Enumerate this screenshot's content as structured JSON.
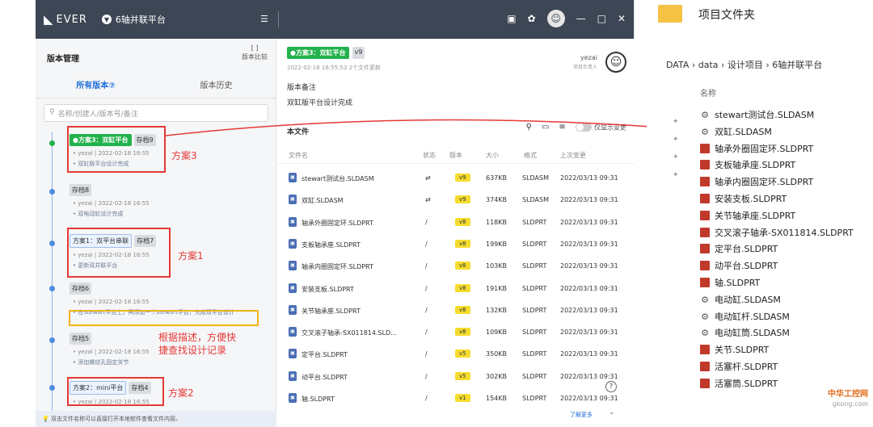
{
  "titlebar": {
    "logo": "EVER",
    "project": "6轴并联平台",
    "menu_icon": "hamburger-icon"
  },
  "left": {
    "title": "版本管理",
    "compare": "版本比较",
    "tabs": [
      {
        "label": "所有版本⑦"
      },
      {
        "label": "版本历史"
      }
    ],
    "search_placeholder": "名称/创建人/版本号/备注",
    "versions": [
      {
        "name": "●方案3：双缸平台",
        "save": "存档9",
        "meta": "• yezai | 2022-02-18 16:55",
        "desc": "• 双缸版平台设计完成"
      },
      {
        "save": "存档8",
        "meta": "• yezai | 2022-02-18 16:55",
        "desc": "• 双电动缸设计完成"
      },
      {
        "name": "方案1：双平台串联",
        "save": "存档7",
        "meta": "• yezai | 2022-02-18 16:55",
        "desc": "• 更新双并联平台"
      },
      {
        "save": "存档6",
        "meta": "• yezai | 2022-02-18 16:55",
        "desc": "• 在Stewart平台上，再添加一个stewart平台，完成双平台设计"
      },
      {
        "save": "存档5",
        "meta": "• yezai | 2022-02-18 16:55",
        "desc": "• 添加螺纹孔固定关节"
      },
      {
        "name": "方案2：mini平台",
        "save": "存档4",
        "meta": "• yezai | 2022-02-18 16:55"
      }
    ],
    "footer": "双击文件名称可以直接打开本地软件查看文件内容。"
  },
  "annotations": {
    "plan3": "方案3",
    "plan1": "方案1",
    "desc": "根据描述，方便快\n捷查找设计记录",
    "plan2": "方案2"
  },
  "mid": {
    "plan": "●方案3：双缸平台",
    "plan_ver": "v9",
    "sub": "2022-02-18 16:55:53 2个文件更新",
    "user": "yezai",
    "user_role": "项目负责人",
    "note_label": "版本备注",
    "note_text": "双缸版平台设计完成",
    "files_header": "本文件",
    "toggle_label": "仅显示变更",
    "columns": [
      "文件名",
      "状态",
      "版本",
      "大小",
      "格式",
      "上次变更"
    ],
    "files": [
      {
        "name": "stewart测试台.SLDASM",
        "status": "⇄",
        "ver": "v9",
        "size": "637KB",
        "fmt": "SLDASM",
        "date": "2022/03/13 09:31"
      },
      {
        "name": "双缸.SLDASM",
        "status": "⇄",
        "ver": "v9",
        "size": "374KB",
        "fmt": "SLDASM",
        "date": "2022/03/13 09:31"
      },
      {
        "name": "轴承外圈固定环.SLDPRT",
        "status": "/",
        "ver": "v8",
        "size": "118KB",
        "fmt": "SLDPRT",
        "date": "2022/03/13 09:31"
      },
      {
        "name": "支板轴承座.SLDPRT",
        "status": "/",
        "ver": "v8",
        "size": "199KB",
        "fmt": "SLDPRT",
        "date": "2022/03/13 09:31"
      },
      {
        "name": "轴承内圈固定环.SLDPRT",
        "status": "/",
        "ver": "v8",
        "size": "103KB",
        "fmt": "SLDPRT",
        "date": "2022/03/13 09:31"
      },
      {
        "name": "安装支板.SLDPRT",
        "status": "/",
        "ver": "v8",
        "size": "191KB",
        "fmt": "SLDPRT",
        "date": "2022/03/13 09:31"
      },
      {
        "name": "关节轴承座.SLDPRT",
        "status": "/",
        "ver": "v8",
        "size": "132KB",
        "fmt": "SLDPRT",
        "date": "2022/03/13 09:31"
      },
      {
        "name": "交叉滚子轴承-SX011814.SLD...",
        "status": "/",
        "ver": "v8",
        "size": "109KB",
        "fmt": "SLDPRT",
        "date": "2022/03/13 09:31"
      },
      {
        "name": "定平台.SLDPRT",
        "status": "/",
        "ver": "v5",
        "size": "350KB",
        "fmt": "SLDPRT",
        "date": "2022/03/13 09:31"
      },
      {
        "name": "动平台.SLDPRT",
        "status": "/",
        "ver": "v5",
        "size": "302KB",
        "fmt": "SLDPRT",
        "date": "2022/03/13 09:31"
      },
      {
        "name": "轴.SLDPRT",
        "status": "/",
        "ver": "v1",
        "size": "154KB",
        "fmt": "SLDPRT",
        "date": "2022/03/13 09:31"
      }
    ],
    "more": "了解更多"
  },
  "right": {
    "title": "项目文件夹",
    "breadcrumb": "DATA  ›  data  ›  设计项目  ›  6轴并联平台",
    "col": "名称",
    "files": [
      "stewart测试台.SLDASM",
      "双缸.SLDASM",
      "轴承外圈固定环.SLDPRT",
      "支板轴承座.SLDPRT",
      "轴承内圈固定环.SLDPRT",
      "安装支板.SLDPRT",
      "关节轴承座.SLDPRT",
      "交叉滚子轴承-SX011814.SLDPRT",
      "定平台.SLDPRT",
      "动平台.SLDPRT",
      "轴.SLDPRT",
      "电动缸.SLDASM",
      "电动缸杆.SLDASM",
      "电动缸筒.SLDASM",
      "关节.SLDPRT",
      "活塞杆.SLDPRT",
      "活塞筒.SLDPRT"
    ],
    "asm_flags": [
      true,
      true,
      false,
      false,
      false,
      false,
      false,
      false,
      false,
      false,
      false,
      true,
      true,
      true,
      false,
      false,
      false
    ]
  },
  "watermark": {
    "line1": "中华工控网",
    "line2": "gkong.com"
  }
}
